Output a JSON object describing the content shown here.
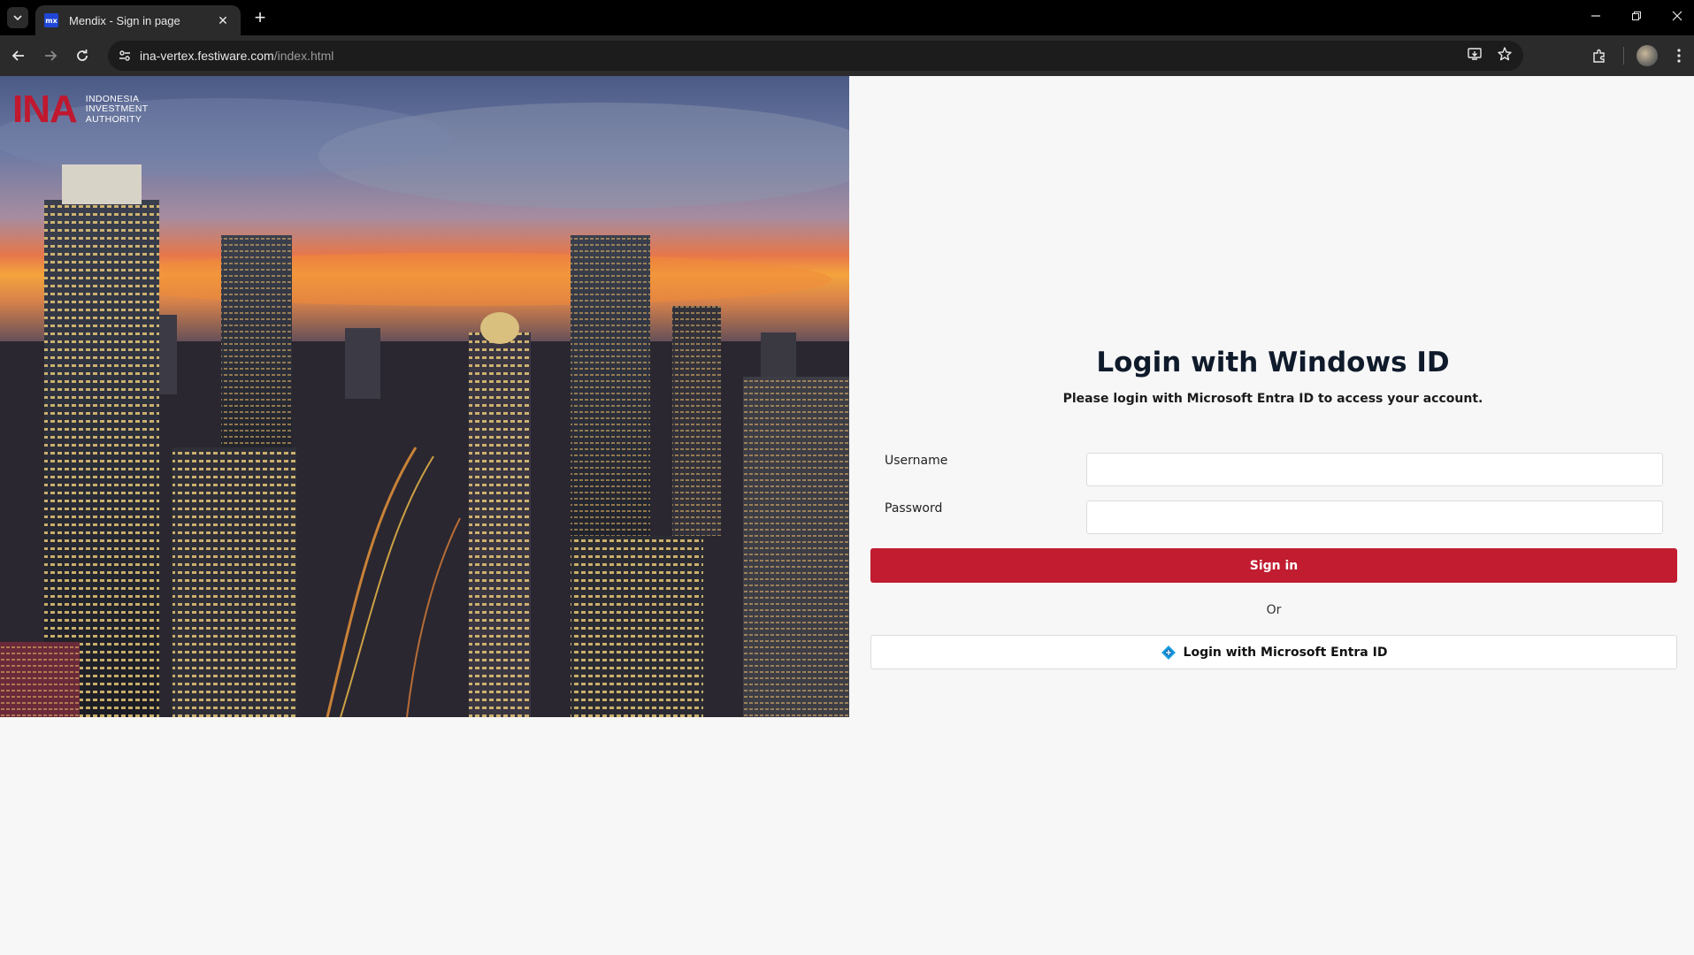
{
  "browser": {
    "tab_title": "Mendix - Sign in page",
    "favicon_text": "mx",
    "url_host": "ina-vertex.festiware.com",
    "url_path": "/index.html",
    "new_tab_glyph": "+",
    "close_glyph": "✕"
  },
  "logo": {
    "mark": "INA",
    "line1": "INDONESIA",
    "line2": "INVESTMENT",
    "line3": "AUTHORITY"
  },
  "login": {
    "heading": "Login with Windows ID",
    "subheading": "Please login with Microsoft Entra ID to access your account.",
    "username_label": "Username",
    "username_value": "",
    "password_label": "Password",
    "password_value": "",
    "signin_label": "Sign in",
    "or_label": "Or",
    "entra_label": "Login with Microsoft Entra ID"
  },
  "colors": {
    "brand_red": "#c11c30",
    "heading": "#0f1a2b",
    "entra_blue": "#1ba1e2"
  },
  "icons": [
    "tab-search-icon",
    "close-icon",
    "back-icon",
    "forward-icon",
    "reload-icon",
    "site-info-icon",
    "install-app-icon",
    "star-icon",
    "extensions-icon",
    "menu-icon",
    "entra-id-icon"
  ]
}
